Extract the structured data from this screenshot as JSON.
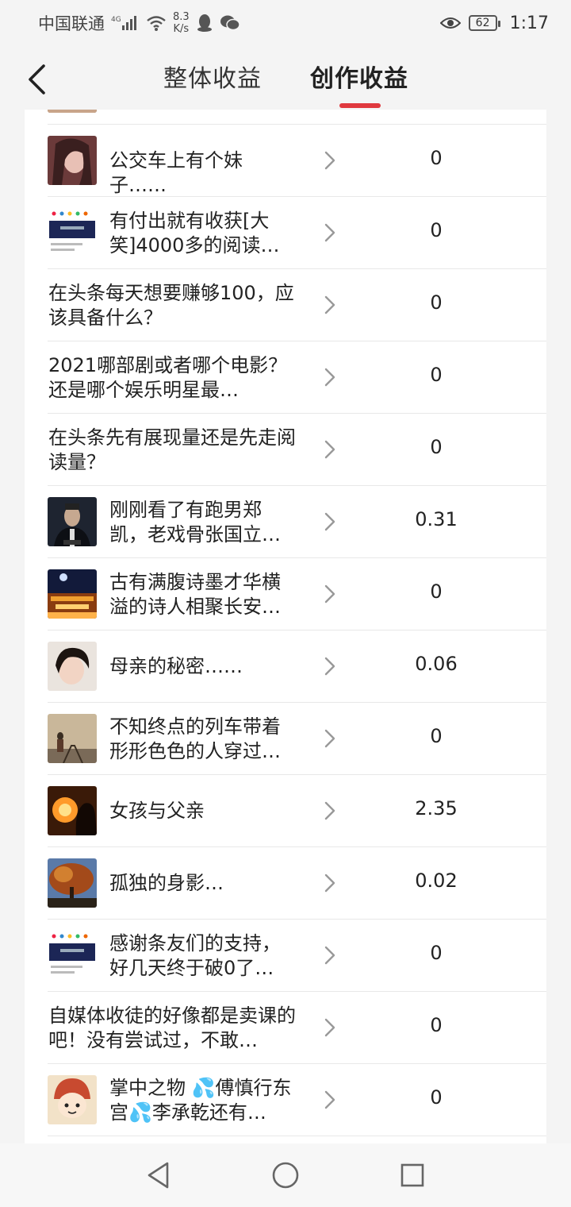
{
  "status_bar": {
    "carrier": "中国联通",
    "network": "4G",
    "speed_value": "8.3",
    "speed_unit": "K/s",
    "battery": "62",
    "time": "1:17",
    "icons": [
      "signal-icon",
      "wifi-icon",
      "qq-icon",
      "wechat-icon",
      "eye-icon",
      "battery-icon"
    ]
  },
  "header": {
    "tabs": [
      {
        "label": "整体收益",
        "active": false
      },
      {
        "label": "创作收益",
        "active": true
      }
    ],
    "accent_color": "#e0393e"
  },
  "list": {
    "items": [
      {
        "title": "…",
        "value": "",
        "thumb": "portrait-partial"
      },
      {
        "title": "公交车上有个妹子……",
        "value": "0",
        "thumb": "woman-portrait"
      },
      {
        "title": "有付出就有收获[大笑]4000多的阅读…",
        "value": "0",
        "thumb": "screenshot-banner"
      },
      {
        "title": "在头条每天想要赚够100，应该具备什么？",
        "value": "0",
        "thumb": null
      },
      {
        "title": "2021哪部剧或者哪个电影？还是哪个娱乐明星最…",
        "value": "0",
        "thumb": null
      },
      {
        "title": "在头条先有展现量还是先走阅读量？",
        "value": "0",
        "thumb": null
      },
      {
        "title": "刚刚看了有跑男郑凯，老戏骨张国立…",
        "value": "0.31",
        "thumb": "man-suit"
      },
      {
        "title": "古有满腹诗墨才华横溢的诗人相聚长安…",
        "value": "0",
        "thumb": "night-palace"
      },
      {
        "title": "母亲的秘密……",
        "value": "0.06",
        "thumb": "child-portrait"
      },
      {
        "title": "不知终点的列车带着形形色色的人穿过…",
        "value": "0",
        "thumb": "railway-girl"
      },
      {
        "title": "女孩与父亲",
        "value": "2.35",
        "thumb": "sunset-silhouette"
      },
      {
        "title": "孤独的身影…",
        "value": "0.02",
        "thumb": "autumn-tree"
      },
      {
        "title": "感谢条友们的支持，好几天终于破0了…",
        "value": "0",
        "thumb": "screenshot-banner"
      },
      {
        "title": "自媒体收徒的好像都是卖课的吧！没有尝试过，不敢…",
        "value": "0",
        "thumb": null
      },
      {
        "title": "掌中之物 💦傅慎行东宫💦李承乾还有…",
        "value": "0",
        "thumb": "cartoon-avatar"
      }
    ]
  },
  "nav_bar": {
    "buttons": [
      "back-triangle-icon",
      "home-circle-icon",
      "recent-square-icon"
    ]
  }
}
